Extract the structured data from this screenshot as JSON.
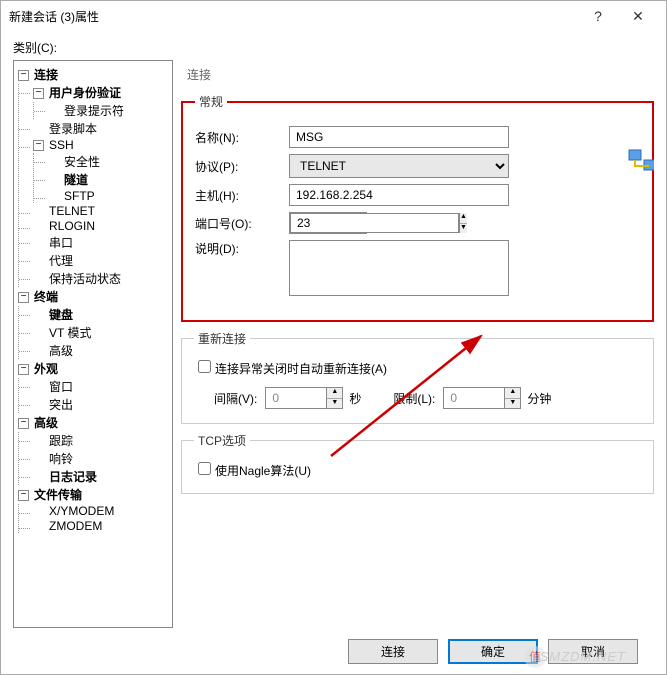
{
  "title": "新建会话 (3)属性",
  "category_label": "类别(C):",
  "tree": {
    "connection": "连接",
    "auth": "用户身份验证",
    "login_prompt": "登录提示符",
    "login_script": "登录脚本",
    "ssh": "SSH",
    "security": "安全性",
    "tunnel": "隧道",
    "sftp": "SFTP",
    "telnet": "TELNET",
    "rlogin": "RLOGIN",
    "serial": "串口",
    "proxy": "代理",
    "keepalive": "保持活动状态",
    "terminal": "终端",
    "keyboard": "键盘",
    "vtmode": "VT 模式",
    "advanced_term": "高级",
    "appearance": "外观",
    "window": "窗口",
    "highlight": "突出",
    "advanced": "高级",
    "trace": "跟踪",
    "bell": "响铃",
    "logging": "日志记录",
    "filetransfer": "文件传输",
    "xymodem": "X/YMODEM",
    "zmodem": "ZMODEM"
  },
  "section_title": "连接",
  "general": {
    "legend": "常规",
    "name_label": "名称(N):",
    "name_value": "MSG",
    "protocol_label": "协议(P):",
    "protocol_value": "TELNET",
    "host_label": "主机(H):",
    "host_value": "192.168.2.254",
    "port_label": "端口号(O):",
    "port_value": "23",
    "desc_label": "说明(D):",
    "desc_value": ""
  },
  "reconnect": {
    "legend": "重新连接",
    "auto_label": "连接异常关闭时自动重新连接(A)",
    "interval_label": "间隔(V):",
    "interval_value": "0",
    "seconds": "秒",
    "limit_label": "限制(L):",
    "limit_value": "0",
    "minutes": "分钟"
  },
  "tcp": {
    "legend": "TCP选项",
    "nagle_label": "使用Nagle算法(U)"
  },
  "buttons": {
    "connect": "连接",
    "ok": "确定",
    "cancel": "取消"
  },
  "watermark": "SMZDM.NET"
}
